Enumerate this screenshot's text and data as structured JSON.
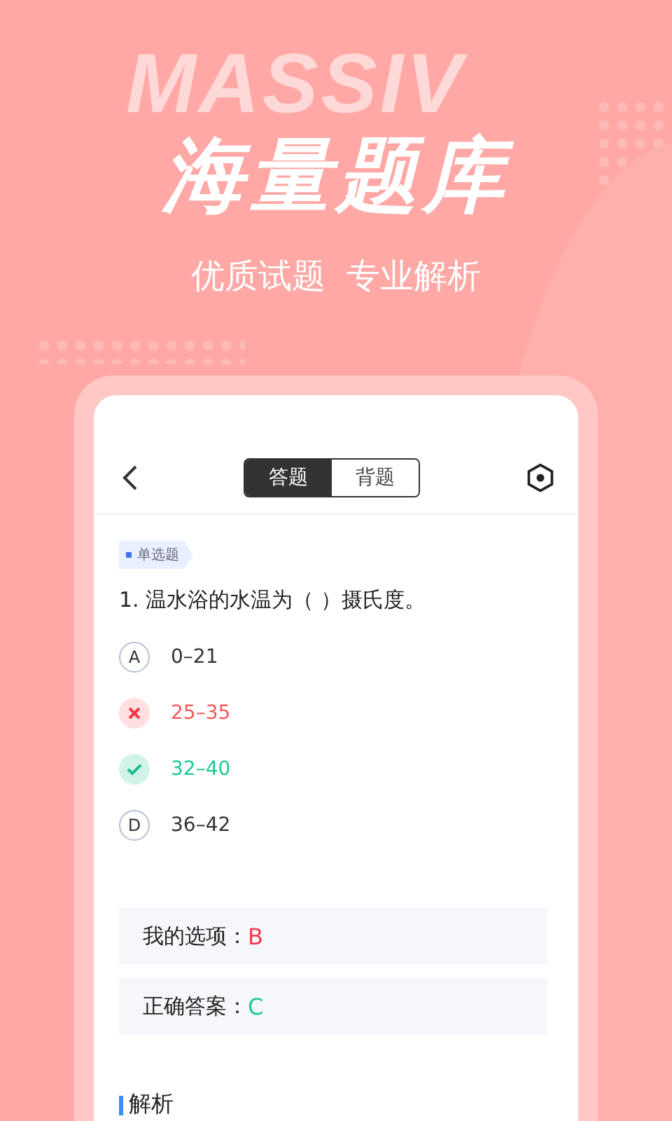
{
  "background_word": "MASSIV",
  "headline": "海量题库",
  "subtitle": "优质试题  专业解析",
  "phone": {
    "nav": {
      "tabs": [
        {
          "label": "答题",
          "selected": true
        },
        {
          "label": "背题",
          "selected": false
        }
      ]
    },
    "question": {
      "tag": "单选题",
      "text": "1. 温水浴的水温为（ ）摄氏度。",
      "options": [
        {
          "kind": "plain",
          "letter": "A",
          "text": "0–21"
        },
        {
          "kind": "wrong",
          "text": "25–35"
        },
        {
          "kind": "correct",
          "text": "32–40"
        },
        {
          "kind": "plain",
          "letter": "D",
          "text": "36–42"
        }
      ]
    },
    "answers": [
      {
        "kind": "mine",
        "label": "我的选项：",
        "value": "B"
      },
      {
        "kind": "correct",
        "label": "正确答案：",
        "value": "C"
      }
    ],
    "analysis_title": "解析"
  }
}
